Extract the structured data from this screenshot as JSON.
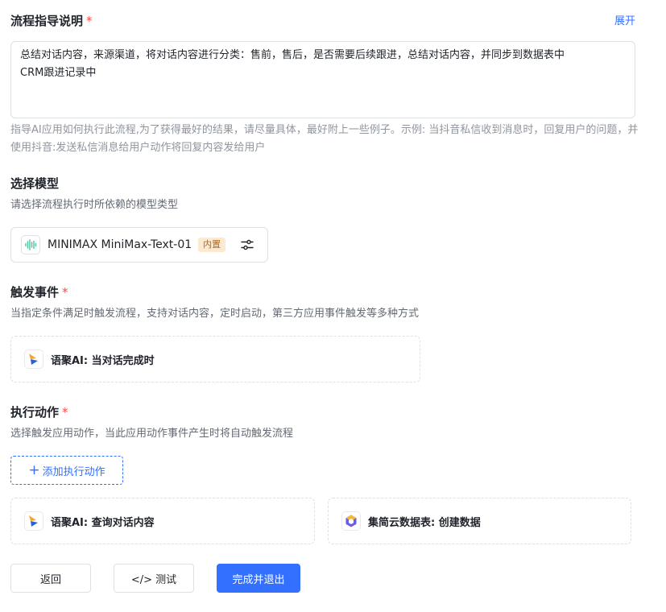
{
  "instructions": {
    "title": "流程指导说明",
    "required_mark": "*",
    "expand_label": "展开",
    "content_line1": "总结对话内容，来源渠道，将对话内容进行分类：售前，售后，是否需要后续跟进，总结对话内容，并同步到数据表中",
    "content_line2": "CRM跟进记录中",
    "hint": "指导AI应用如何执行此流程,为了获得最好的结果，请尽量具体，最好附上一些例子。示例: 当抖音私信收到消息时，回复用户的问题，并使用抖音:发送私信消息给用户动作将回复内容发给用户"
  },
  "model": {
    "title": "选择模型",
    "description": "请选择流程执行时所依赖的模型类型",
    "name": "MINIMAX MiniMax-Text-01",
    "badge": "内置",
    "icon": "waveform-icon",
    "settings_icon": "sliders-icon"
  },
  "trigger": {
    "title": "触发事件",
    "required_mark": "*",
    "description": "当指定条件满足时触发流程，支持对话内容，定时启动，第三方应用事件触发等多种方式",
    "card_label": "语聚AI: 当对话完成时",
    "card_icon": "yuju-logo-icon"
  },
  "actions": {
    "title": "执行动作",
    "required_mark": "*",
    "description": "选择触发应用动作，当此应用动作事件产生时将自动触发流程",
    "add_label": "添加执行动作",
    "add_icon": "plus-icon",
    "items": [
      {
        "label": "语聚AI: 查询对话内容",
        "icon": "yuju-logo-icon"
      },
      {
        "label": "集简云数据表: 创建数据",
        "icon": "jijianyun-logo-icon"
      }
    ]
  },
  "footer": {
    "back_label": "返回",
    "test_label": "</> 测试",
    "finish_label": "完成并退出"
  },
  "colors": {
    "primary": "#3370ff",
    "required": "#f54a45",
    "badge_bg": "#fde9d0",
    "badge_text": "#b26a1e"
  }
}
